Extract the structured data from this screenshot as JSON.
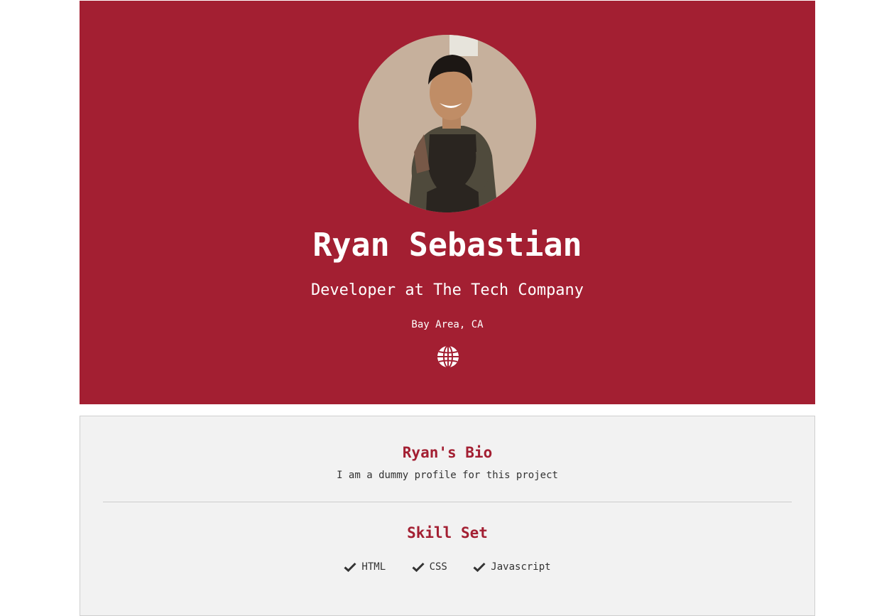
{
  "profile": {
    "name": "Ryan Sebastian",
    "title": "Developer at The Tech Company",
    "location": "Bay Area, CA",
    "website_icon": "globe-icon",
    "avatar_alt": "Ryan Sebastian photo"
  },
  "bio": {
    "heading": "Ryan's Bio",
    "text": "I am a dummy profile for this project"
  },
  "skills": {
    "heading": "Skill Set",
    "check_icon": "check-icon",
    "items": [
      "HTML",
      "CSS",
      "Javascript"
    ]
  },
  "colors": {
    "brand": "#a31f32",
    "card_bg": "#f2f2f2",
    "text": "#333333"
  }
}
